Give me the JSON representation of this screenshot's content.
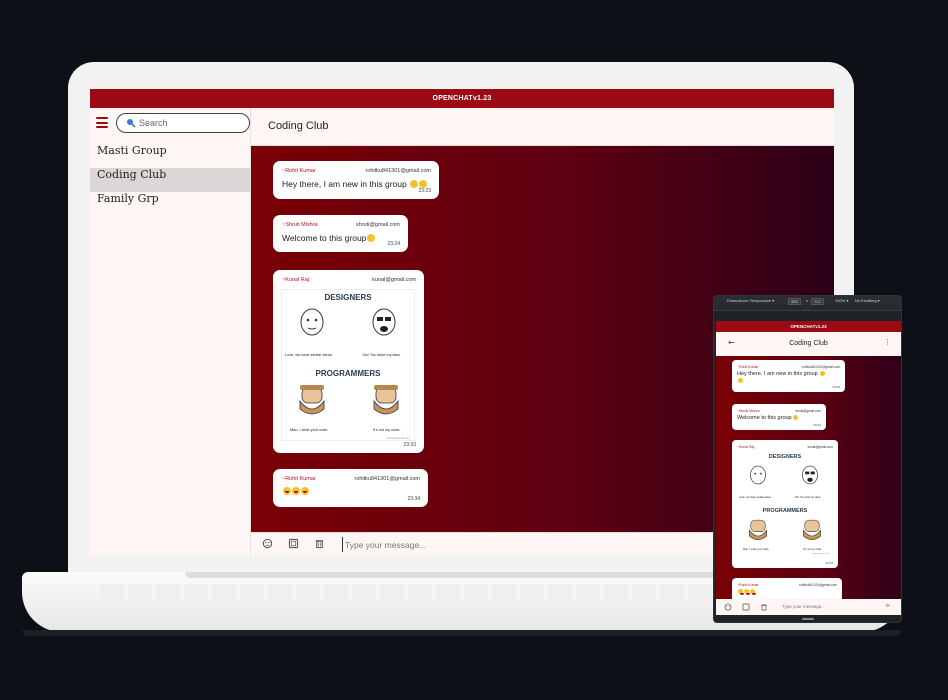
{
  "app": {
    "title": "OPENCHATv1.23"
  },
  "sidebar": {
    "search_placeholder": "Search",
    "groups": [
      {
        "label": "Masti Group",
        "active": false
      },
      {
        "label": "Coding Club",
        "active": true
      },
      {
        "label": "Family Grp",
        "active": false
      }
    ]
  },
  "chat": {
    "title": "Coding Club",
    "messages": [
      {
        "sender": "~Rohit Kumar",
        "email": "rohitku841301@gmail.com",
        "text": "Hey there, I am new in this group",
        "time": "23:23"
      },
      {
        "sender": "~Shruti Mishra",
        "email": "shruti@gmail.com",
        "text": "Welcome to this group",
        "time": "23:24"
      },
      {
        "sender": "~Kunal Raj",
        "email": "kunal@gmail.com",
        "time": "23:33",
        "meme": {
          "top": "DESIGNERS",
          "bottom": "PROGRAMMERS",
          "cap1": "Look, we have similar ideas.",
          "cap2": "No! You stole my idea.",
          "cap3": "Man, I stole your code.",
          "cap4": "It's not my code.",
          "watermark": "bored panda.com"
        }
      },
      {
        "sender": "~Rohit Kumar",
        "email": "rohitku841301@gmail.com",
        "text": "",
        "time": "23:34"
      }
    ]
  },
  "composer": {
    "placeholder": "Type your message..."
  },
  "devtools": {
    "dimensions": "Dimensions: Responsive ▾",
    "width": "400",
    "x": "x",
    "height": "717",
    "zoom": "100% ▾",
    "throttle": "No throttling ▾"
  },
  "phone": {
    "back": "←",
    "menu": "⋮",
    "send": "⊳"
  },
  "colors": {
    "brand": "#9c0b14",
    "chat_bg_start": "#7a0006",
    "chat_bg_end": "#2c0018"
  }
}
